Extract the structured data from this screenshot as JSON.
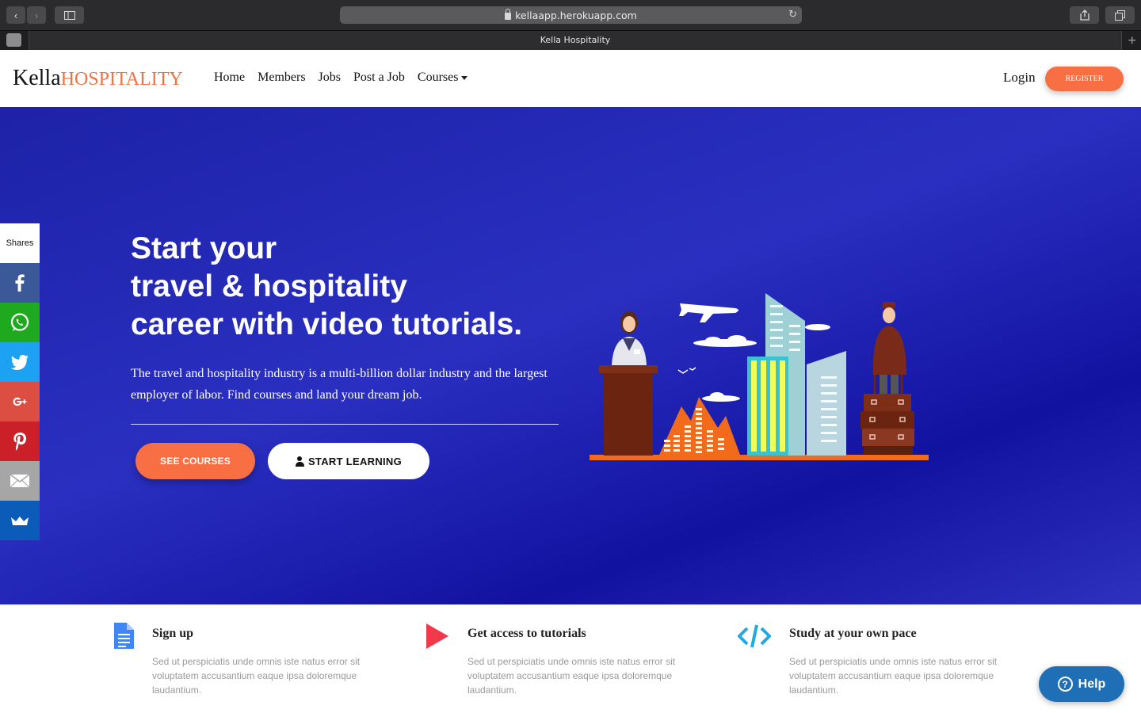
{
  "browser": {
    "url": "kellaapp.herokuapp.com",
    "tab_title": "Kella Hospitality"
  },
  "nav": {
    "logo_main": "Kella",
    "logo_accent": "HOSPITALITY",
    "links": [
      "Home",
      "Members",
      "Jobs",
      "Post a Job",
      "Courses"
    ],
    "login": "Login",
    "register": "REGISTER"
  },
  "hero": {
    "title_lines": [
      "Start your",
      "travel & hospitality",
      "career with video tutorials."
    ],
    "description": "The travel and hospitality industry is a multi-billion dollar industry and the largest employer of labor. Find courses and land your dream job.",
    "btn_courses": "SEE COURSES",
    "btn_learn": "START LEARNING"
  },
  "share": {
    "label": "Shares",
    "items": [
      {
        "name": "facebook",
        "color": "#3b5998"
      },
      {
        "name": "whatsapp",
        "color": "#1fa91f"
      },
      {
        "name": "twitter",
        "color": "#1da1f2"
      },
      {
        "name": "google-plus",
        "color": "#dc4e41"
      },
      {
        "name": "pinterest",
        "color": "#cb2027"
      },
      {
        "name": "email",
        "color": "#a6a6a6"
      },
      {
        "name": "sumo",
        "color": "#0b5cb8"
      }
    ]
  },
  "features": [
    {
      "title": "Sign up",
      "text": "Sed ut perspiciatis unde omnis iste natus error sit voluptatem accusantium eaque ipsa doloremque laudantium.",
      "icon": "document-icon"
    },
    {
      "title": "Get access to tutorials",
      "text": "Sed ut perspiciatis unde omnis iste natus error sit voluptatem accusantium eaque ipsa doloremque laudantium.",
      "icon": "play-icon"
    },
    {
      "title": "Study at your own pace",
      "text": "Sed ut perspiciatis unde omnis iste natus error sit voluptatem accusantium eaque ipsa doloremque laudantium.",
      "icon": "code-icon"
    }
  ],
  "help": {
    "label": "Help"
  },
  "colors": {
    "accent": "#f76f43",
    "hero": "#1d22a8",
    "help": "#1e6fb6"
  }
}
